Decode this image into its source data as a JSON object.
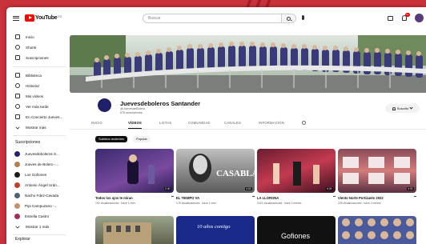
{
  "header": {
    "logo_text": "YouTube",
    "logo_country": "ES",
    "search_placeholder": "Buscar",
    "notification_count": "9+",
    "icons": [
      "menu-icon",
      "search-icon",
      "mic-icon",
      "create-icon",
      "bell-icon",
      "avatar"
    ]
  },
  "sidebar": {
    "primary": [
      {
        "label": "Inicio",
        "icon": "home-icon"
      },
      {
        "label": "Shorts",
        "icon": "shorts-icon"
      },
      {
        "label": "Suscripciones",
        "icon": "subscriptions-icon"
      }
    ],
    "library": [
      {
        "label": "Biblioteca",
        "icon": "library-icon"
      },
      {
        "label": "Historial",
        "icon": "history-icon"
      },
      {
        "label": "Mis vídeos",
        "icon": "my-videos-icon"
      },
      {
        "label": "Ver más tarde",
        "icon": "watch-later-icon"
      },
      {
        "label": "En Concierto Jueves...",
        "icon": "playlist-icon"
      },
      {
        "label": "Mostrar más",
        "icon": "chevron-down-icon"
      }
    ],
    "subs_title": "Suscripciones",
    "subscriptions": [
      {
        "label": "Juevesdeboleros S...",
        "color": "#22226e"
      },
      {
        "label": "Jueves de Bolero -...",
        "color": "#b08050"
      },
      {
        "label": "Los Gofiones",
        "color": "#1a1a1a"
      },
      {
        "label": "Antonio Ángel Urán...",
        "color": "#c04030"
      },
      {
        "label": "Nacho Fdez-Cavada",
        "color": "#506070"
      },
      {
        "label": "Pipi Campuzano -...",
        "color": "#c09070"
      },
      {
        "label": "Estrella Castro",
        "color": "#a03050"
      },
      {
        "label": "Mostrar 1 más",
        "color": ""
      }
    ],
    "explore_title": "Explorar",
    "explore": [
      {
        "label": "Tendencias",
        "icon": "trending-icon"
      }
    ]
  },
  "channel": {
    "name": "Juevesdeboleros Santander",
    "handle": "@JuevesdeBolero",
    "subscribers": "678 suscriptores",
    "subscribe_label": "Suscrito"
  },
  "tabs": [
    "INICIO",
    "VÍDEOS",
    "LISTAS",
    "COMUNIDAD",
    "CANALES",
    "INFORMACIÓN"
  ],
  "active_tab": "VÍDEOS",
  "chips": [
    "Subidos recientes",
    "Popular"
  ],
  "videos": [
    {
      "title": "Todos los ojos te miran",
      "meta": "192 visualizaciones · hace 1 mes",
      "duration": "2:40"
    },
    {
      "title": "EL TIEMPO VA",
      "meta": "178 visualizaciones · hace 1 mes",
      "duration": "4:02"
    },
    {
      "title": "LA LLORONA",
      "meta": "1021 visualizaciones · hace 2 meses",
      "duration": "6:30"
    },
    {
      "title": "Viento Norte Portizuelo 2022",
      "meta": "225 visualizaciones · hace 2 meses",
      "duration": "4:30"
    }
  ],
  "videos_row2": [
    {
      "overlay": ""
    },
    {
      "overlay": "10 años contigo"
    },
    {
      "overlay": "Gofiones"
    },
    {
      "overlay": ""
    }
  ]
}
